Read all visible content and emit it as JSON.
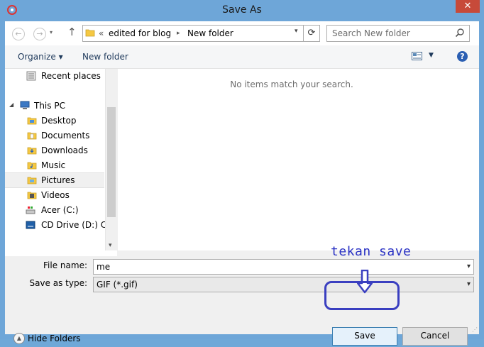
{
  "window": {
    "title": "Save As",
    "close_label": "✕"
  },
  "address": {
    "prefix": "«",
    "crumbs": [
      "edited for blog",
      "New folder"
    ],
    "separator": "▸",
    "search_placeholder": "Search New folder"
  },
  "toolbar": {
    "organize_label": "Organize ▾",
    "new_folder_label": "New folder",
    "help_label": "?"
  },
  "nav": {
    "items": [
      {
        "label": "Recent places",
        "icon": "recent-places-icon"
      },
      {
        "label": "This PC",
        "icon": "computer-icon"
      },
      {
        "label": "Desktop",
        "icon": "folder-icon"
      },
      {
        "label": "Documents",
        "icon": "folder-icon"
      },
      {
        "label": "Downloads",
        "icon": "folder-icon"
      },
      {
        "label": "Music",
        "icon": "folder-icon"
      },
      {
        "label": "Pictures",
        "icon": "folder-icon",
        "selected": true
      },
      {
        "label": "Videos",
        "icon": "folder-icon"
      },
      {
        "label": "Acer (C:)",
        "icon": "drive-icon"
      },
      {
        "label": "CD Drive (D:) Cel",
        "icon": "cd-drive-icon"
      }
    ]
  },
  "content": {
    "empty_message": "No items match your search."
  },
  "form": {
    "file_name_label": "File name:",
    "file_name_value": "me",
    "save_type_label": "Save as type:",
    "save_type_value": "GIF (*.gif)"
  },
  "footer": {
    "hide_folders_label": "Hide Folders",
    "save_label": "Save",
    "cancel_label": "Cancel"
  },
  "annotation": {
    "text": "tekan save",
    "color": "#2a32c4"
  },
  "colors": {
    "title_bar": "#6ea6d8",
    "close_button": "#c74a3a",
    "accent": "#3c7fb1"
  }
}
